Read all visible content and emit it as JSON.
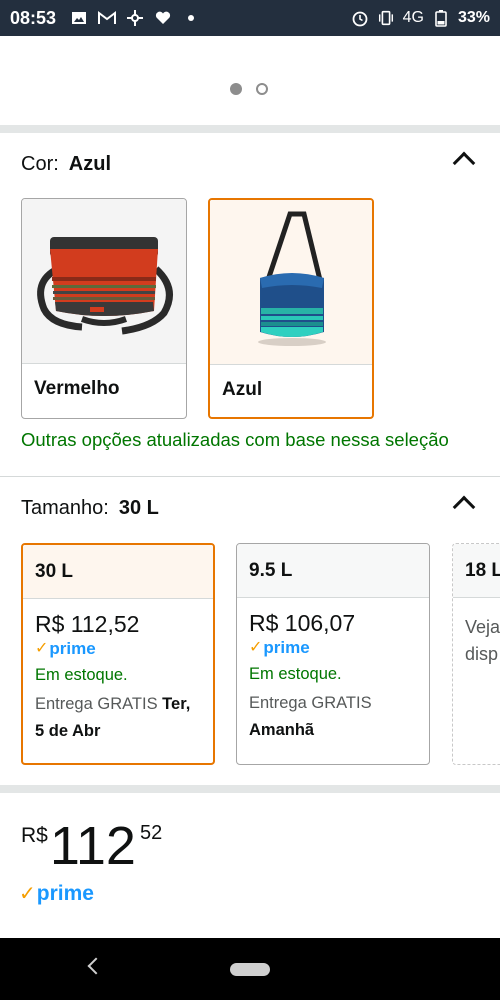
{
  "status_bar": {
    "time": "08:53",
    "network": "4G",
    "battery": "33%",
    "left_icons": [
      "image-icon",
      "gmail-icon",
      "pinwheel-icon",
      "heart-icon",
      "dot-icon"
    ],
    "right_icons": [
      "alarm-icon",
      "vibrate-icon",
      "battery-icon"
    ]
  },
  "carousel": {
    "pages": 2,
    "active_index": 0
  },
  "color_section": {
    "label": "Cor:",
    "value": "Azul",
    "options": [
      {
        "name": "Vermelho",
        "image": "red-cooler-bag",
        "selected": false
      },
      {
        "name": "Azul",
        "image": "blue-cooler-bag",
        "selected": true
      }
    ],
    "update_note": "Outras opções atualizadas com base nessa seleção"
  },
  "size_section": {
    "label": "Tamanho:",
    "value": "30 L",
    "options": [
      {
        "size": "30 L",
        "price": "R$ 112,52",
        "prime": "prime",
        "stock": "Em estoque.",
        "delivery_prefix": "Entrega GRATIS",
        "delivery_date": "Ter, 5 de Abr",
        "selected": true
      },
      {
        "size": "9.5 L",
        "price": "R$ 106,07",
        "prime": "prime",
        "stock": "Em estoque.",
        "delivery_prefix": "Entrega GRATIS",
        "delivery_date": "Amanhã",
        "selected": false
      },
      {
        "size": "18 L",
        "text": "Veja disp",
        "selected": false
      }
    ]
  },
  "price_block": {
    "currency": "R$",
    "whole": "112",
    "fraction": "52",
    "prime": "prime"
  },
  "colors": {
    "accent": "#e77600",
    "success": "#007600",
    "prime_blue": "#1a98ff",
    "prime_check": "#f59e00",
    "status_bar": "#232f3e"
  }
}
